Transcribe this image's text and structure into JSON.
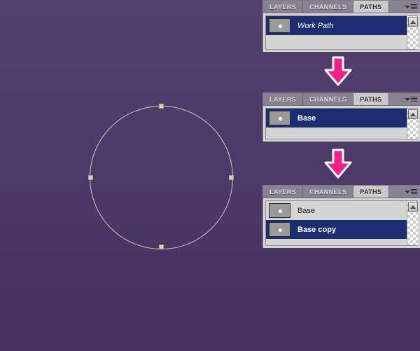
{
  "app": {
    "canvas_bg_top": "#54406e",
    "canvas_bg_bottom": "#452f5e",
    "accent_arrow": "#f51e8c",
    "selection_blue": "#1c2d72",
    "path_stroke": "#c9c9b8",
    "anchor_fill": "#c7dba6"
  },
  "canvas": {
    "path_name": "circle-path",
    "anchors": 4
  },
  "arrows": [
    {
      "name": "flow-arrow-1",
      "direction": "down"
    },
    {
      "name": "flow-arrow-2",
      "direction": "down"
    }
  ],
  "panels": [
    {
      "id": "panel-1",
      "tabs": [
        {
          "label": "LAYERS",
          "active": false
        },
        {
          "label": "CHANNELS",
          "active": false
        },
        {
          "label": "PATHS",
          "active": true
        }
      ],
      "menu_icon": "panel-menu-icon",
      "rows": [
        {
          "label": "Work Path",
          "selected": true,
          "italic": true,
          "bold": false,
          "thumb": "path-thumbnail"
        }
      ]
    },
    {
      "id": "panel-2",
      "tabs": [
        {
          "label": "LAYERS",
          "active": false
        },
        {
          "label": "CHANNELS",
          "active": false
        },
        {
          "label": "PATHS",
          "active": true
        }
      ],
      "menu_icon": "panel-menu-icon",
      "rows": [
        {
          "label": "Base",
          "selected": true,
          "italic": false,
          "bold": true,
          "thumb": "path-thumbnail"
        }
      ]
    },
    {
      "id": "panel-3",
      "tabs": [
        {
          "label": "LAYERS",
          "active": false
        },
        {
          "label": "CHANNELS",
          "active": false
        },
        {
          "label": "PATHS",
          "active": true
        }
      ],
      "menu_icon": "panel-menu-icon",
      "rows": [
        {
          "label": "Base",
          "selected": false,
          "italic": false,
          "bold": false,
          "thumb": "path-thumbnail"
        },
        {
          "label": "Base copy",
          "selected": true,
          "italic": false,
          "bold": true,
          "thumb": "path-thumbnail"
        }
      ]
    }
  ]
}
